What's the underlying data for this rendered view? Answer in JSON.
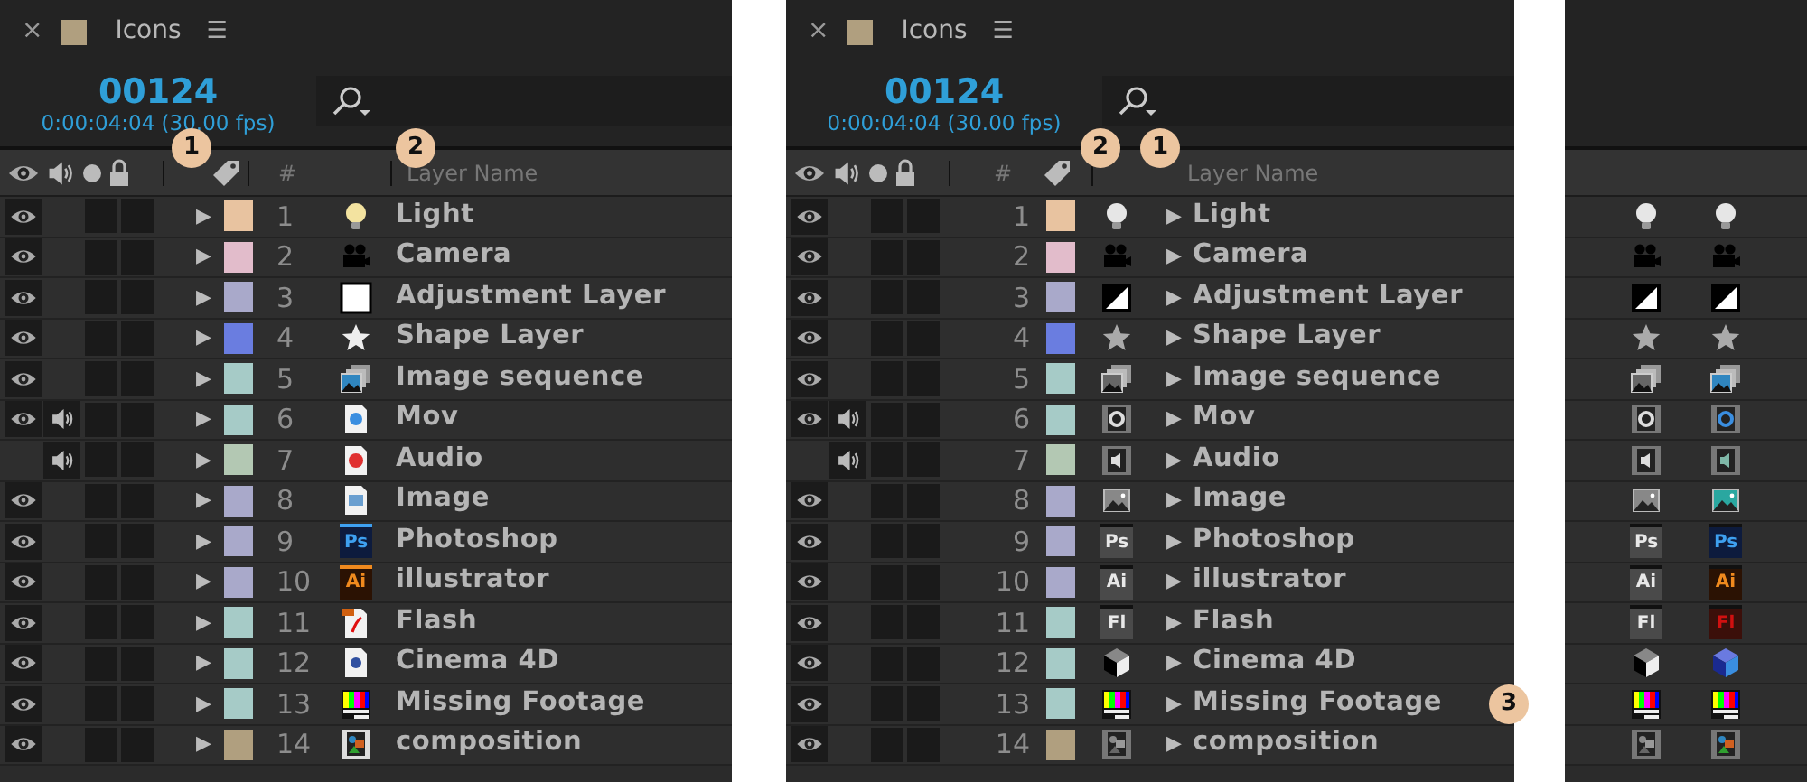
{
  "panels": [
    {
      "kind": "label_first",
      "tab": {
        "close": "×",
        "color": "#b09f7f",
        "title": "Icons",
        "menu": "☰"
      },
      "timecode": "00124",
      "time": "0:00:04:04 (30.00 fps)",
      "header": {
        "number": "#",
        "name": "Layer Name",
        "label_callout": "1",
        "name_callout": "2"
      },
      "layers": [
        {
          "number": "1",
          "expander": "▶",
          "name": "Light",
          "kind": "light",
          "color": "#e8c3a0",
          "video": true,
          "audio": false
        },
        {
          "number": "2",
          "expander": "▶",
          "name": "Camera",
          "kind": "camera",
          "color": "#e2bccb",
          "video": true,
          "audio": false
        },
        {
          "number": "3",
          "expander": "▶",
          "name": "Adjustment Layer",
          "kind": "adjustment",
          "color": "#a9a9ca",
          "video": true,
          "audio": false
        },
        {
          "number": "4",
          "expander": "▶",
          "name": "Shape Layer",
          "kind": "shape",
          "color": "#6a7de0",
          "video": true,
          "audio": false
        },
        {
          "number": "5",
          "expander": "▶",
          "name": "Image sequence",
          "kind": "sequence",
          "color": "#a6cbc7",
          "video": true,
          "audio": false
        },
        {
          "number": "6",
          "expander": "▶",
          "name": "Mov",
          "kind": "movie",
          "color": "#a6cbc7",
          "video": true,
          "audio": true
        },
        {
          "number": "7",
          "expander": "▶",
          "name": "Audio",
          "kind": "audio",
          "color": "#b3c8b3",
          "video": false,
          "audio": true
        },
        {
          "number": "8",
          "expander": "▶",
          "name": "Image",
          "kind": "image",
          "color": "#a9a9ca",
          "video": true,
          "audio": false
        },
        {
          "number": "9",
          "expander": "▶",
          "name": "Photoshop",
          "kind": "photoshop",
          "label": "Ps",
          "color": "#a9a9ca",
          "video": true,
          "audio": false
        },
        {
          "number": "10",
          "expander": "▶",
          "name": "illustrator",
          "kind": "illustrator",
          "label": "Ai",
          "color": "#a9a9ca",
          "video": true,
          "audio": false
        },
        {
          "number": "11",
          "expander": "▶",
          "name": "Flash",
          "kind": "flash",
          "color": "#a6cbc7",
          "video": true,
          "audio": false
        },
        {
          "number": "12",
          "expander": "▶",
          "name": "Cinema 4D",
          "kind": "cinema4d",
          "color": "#a6cbc7",
          "video": true,
          "audio": false
        },
        {
          "number": "13",
          "expander": "▶",
          "name": "Missing Footage",
          "kind": "missing",
          "color": "#a6cbc7",
          "video": true,
          "audio": false
        },
        {
          "number": "14",
          "expander": "▶",
          "name": "composition",
          "kind": "composition",
          "color": "#b09f7f",
          "video": true,
          "audio": false
        }
      ]
    },
    {
      "kind": "number_first",
      "tab": {
        "close": "×",
        "color": "#b09f7f",
        "title": "Icons",
        "menu": "☰"
      },
      "timecode": "00124",
      "time": "0:00:04:04 (30.00 fps)",
      "header": {
        "number": "#",
        "name": "Layer Name",
        "label_callout": "2",
        "name_callout": "1"
      },
      "layers": [
        {
          "number": "1",
          "expander": "▶",
          "name": "Light",
          "kind": "light",
          "color": "#e8c3a0",
          "video": true,
          "audio": false
        },
        {
          "number": "2",
          "expander": "▶",
          "name": "Camera",
          "kind": "camera",
          "color": "#e2bccb",
          "video": true,
          "audio": false
        },
        {
          "number": "3",
          "expander": "▶",
          "name": "Adjustment Layer",
          "kind": "adjustment",
          "color": "#a9a9ca",
          "video": true,
          "audio": false
        },
        {
          "number": "4",
          "expander": "▶",
          "name": "Shape Layer",
          "kind": "shape",
          "color": "#6a7de0",
          "video": true,
          "audio": false
        },
        {
          "number": "5",
          "expander": "▶",
          "name": "Image sequence",
          "kind": "sequence",
          "color": "#a6cbc7",
          "video": true,
          "audio": false
        },
        {
          "number": "6",
          "expander": "▶",
          "name": "Mov",
          "kind": "movie",
          "color": "#a6cbc7",
          "video": true,
          "audio": true
        },
        {
          "number": "7",
          "expander": "▶",
          "name": "Audio",
          "kind": "audio",
          "color": "#b3c8b3",
          "video": false,
          "audio": true
        },
        {
          "number": "8",
          "expander": "▶",
          "name": "Image",
          "kind": "image",
          "color": "#a9a9ca",
          "video": true,
          "audio": false
        },
        {
          "number": "9",
          "expander": "▶",
          "name": "Photoshop",
          "kind": "photoshop",
          "label": "Ps",
          "color": "#a9a9ca",
          "video": true,
          "audio": false
        },
        {
          "number": "10",
          "expander": "▶",
          "name": "illustrator",
          "kind": "illustrator",
          "label": "Ai",
          "color": "#a9a9ca",
          "video": true,
          "audio": false
        },
        {
          "number": "11",
          "expander": "▶",
          "name": "Flash",
          "kind": "flash",
          "label": "Fl",
          "color": "#a6cbc7",
          "video": true,
          "audio": false
        },
        {
          "number": "12",
          "expander": "▶",
          "name": "Cinema 4D",
          "kind": "cinema4d",
          "color": "#a6cbc7",
          "video": true,
          "audio": false
        },
        {
          "number": "13",
          "expander": "▶",
          "name": "Missing Footage",
          "kind": "missing",
          "color": "#a6cbc7",
          "video": true,
          "audio": false,
          "callout": "3"
        },
        {
          "number": "14",
          "expander": "▶",
          "name": "composition",
          "kind": "composition",
          "color": "#b09f7f",
          "video": true,
          "audio": false
        }
      ]
    }
  ],
  "icon_strip": {
    "columns": [
      {
        "kind": "gray"
      },
      {
        "kind": "color"
      }
    ],
    "rows": [
      {
        "kind": "light"
      },
      {
        "kind": "camera"
      },
      {
        "kind": "adjustment"
      },
      {
        "kind": "shape"
      },
      {
        "kind": "sequence"
      },
      {
        "kind": "movie"
      },
      {
        "kind": "audio"
      },
      {
        "kind": "image"
      },
      {
        "kind": "photoshop",
        "labels": [
          "Ps",
          "Ps"
        ]
      },
      {
        "kind": "illustrator",
        "labels": [
          "Ai",
          "Ai"
        ]
      },
      {
        "kind": "flash",
        "labels": [
          "Fl",
          "Fl"
        ]
      },
      {
        "kind": "cinema4d"
      },
      {
        "kind": "missing"
      },
      {
        "kind": "composition"
      }
    ]
  }
}
